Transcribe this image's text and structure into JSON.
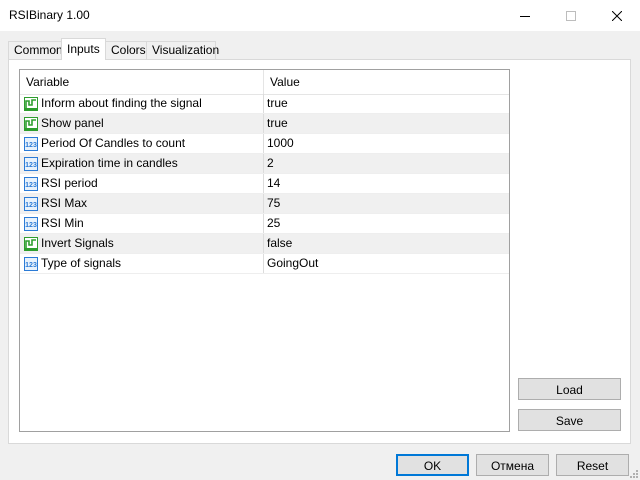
{
  "window": {
    "title": "RSIBinary 1.00"
  },
  "tabs": [
    {
      "label": "Common",
      "active": false
    },
    {
      "label": "Inputs",
      "active": true
    },
    {
      "label": "Colors",
      "active": false
    },
    {
      "label": "Visualization",
      "active": false
    }
  ],
  "table": {
    "headers": {
      "variable": "Variable",
      "value": "Value"
    },
    "rows": [
      {
        "icon": "bool-icon",
        "variable": "Inform about finding the signal",
        "value": "true"
      },
      {
        "icon": "bool-icon",
        "variable": "Show panel",
        "value": "true"
      },
      {
        "icon": "number-icon",
        "variable": "Period Of Candles to count",
        "value": "1000"
      },
      {
        "icon": "number-icon",
        "variable": "Expiration time in candles",
        "value": "2"
      },
      {
        "icon": "number-icon",
        "variable": "RSI period",
        "value": "14"
      },
      {
        "icon": "number-icon",
        "variable": "RSI Max",
        "value": "75"
      },
      {
        "icon": "number-icon",
        "variable": "RSI Min",
        "value": "25"
      },
      {
        "icon": "bool-icon",
        "variable": "Invert Signals",
        "value": "false"
      },
      {
        "icon": "number-icon",
        "variable": "Type of signals",
        "value": "GoingOut"
      }
    ]
  },
  "side_buttons": {
    "load": "Load",
    "save": "Save"
  },
  "footer_buttons": {
    "ok": "OK",
    "cancel": "Отмена",
    "reset": "Reset"
  },
  "colors": {
    "accent": "#0078d7",
    "bool_icon": "#2e9e2e",
    "number_icon": "#2b7bd6"
  }
}
